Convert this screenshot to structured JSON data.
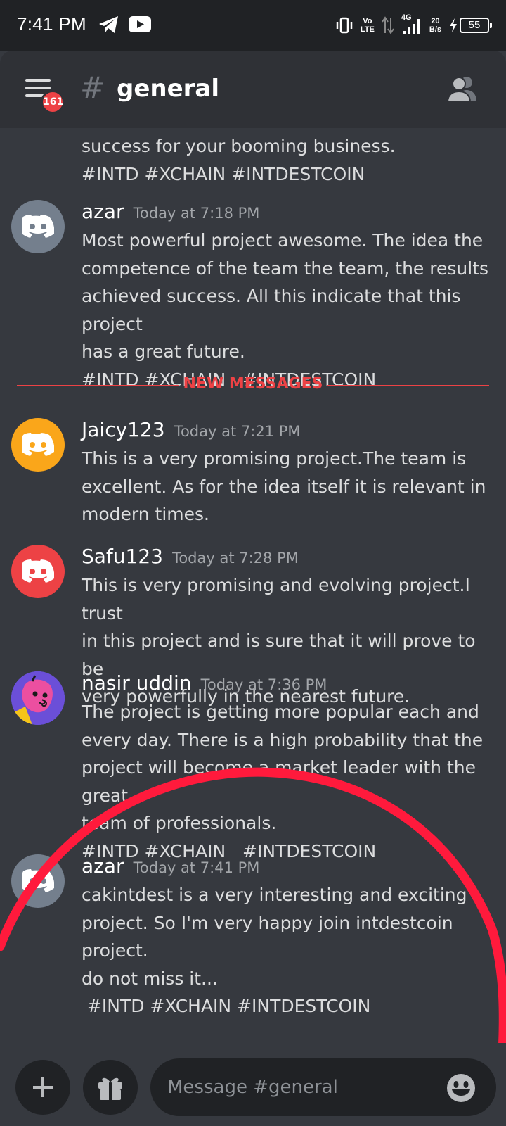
{
  "status_bar": {
    "time": "7:41 PM",
    "volte": "Vo\nLTE",
    "network": "4G",
    "speed": "20\nB/s",
    "battery": "55"
  },
  "header": {
    "unread_badge": "161",
    "hash": "#",
    "channel_name": "general"
  },
  "messages": {
    "top_fragment": "success for your booming business. #INTD #XCHAIN #INTDESTCOIN",
    "new_messages_label": "NEW MESSAGES",
    "items": [
      {
        "username": "azar",
        "timestamp": "Today at 7:18 PM",
        "avatar_color": "#747f8d",
        "lines": [
          "Most powerful project awesome. The idea the",
          "competence of the team the team, the results",
          "achieved success. All this indicate that this project",
          "has a great future.",
          "#INTD #XCHAIN   #INTDESTCOIN"
        ]
      },
      {
        "username": "Jaicy123",
        "timestamp": "Today at 7:21 PM",
        "avatar_color": "#faa61a",
        "lines": [
          "This is a very promising project.The team is",
          "excellent. As for the idea itself it is relevant in",
          "modern times."
        ]
      },
      {
        "username": "Safu123",
        "timestamp": "Today at 7:28 PM",
        "avatar_color": "#ed4245",
        "lines": [
          "This is very promising and evolving project.I trust",
          "in this project and is sure that it will prove to be",
          "very powerfully in the nearest future."
        ]
      },
      {
        "username": "nasir uddin",
        "timestamp": "Today at 7:36 PM",
        "avatar_color": "#5865f2",
        "lines": [
          "The project is getting more popular each and",
          "every day. There is a high probability that the",
          "project will become a market leader with the great",
          "team of professionals.",
          "#INTD #XCHAIN   #INTDESTCOIN"
        ]
      },
      {
        "username": "azar",
        "timestamp": "Today at 7:41 PM",
        "avatar_color": "#747f8d",
        "lines": [
          "cakintdest is a very interesting and exciting",
          "project. So I'm very happy join intdestcoin project.",
          "do not miss it...",
          " #INTD #XCHAIN #INTDESTCOIN"
        ]
      }
    ]
  },
  "composer": {
    "placeholder": "Message #general"
  },
  "icons": {
    "telegram": "telegram-icon",
    "youtube": "youtube-icon",
    "menu": "hamburger-menu-icon",
    "members": "members-icon",
    "add": "plus-icon",
    "gift": "gift-icon",
    "emoji": "emoji-icon",
    "discord": "discord-logo-icon"
  },
  "colors": {
    "background": "#36393f",
    "header": "#2f3136",
    "new_messages": "#ed4245",
    "annotation": "#ff1a3c"
  }
}
